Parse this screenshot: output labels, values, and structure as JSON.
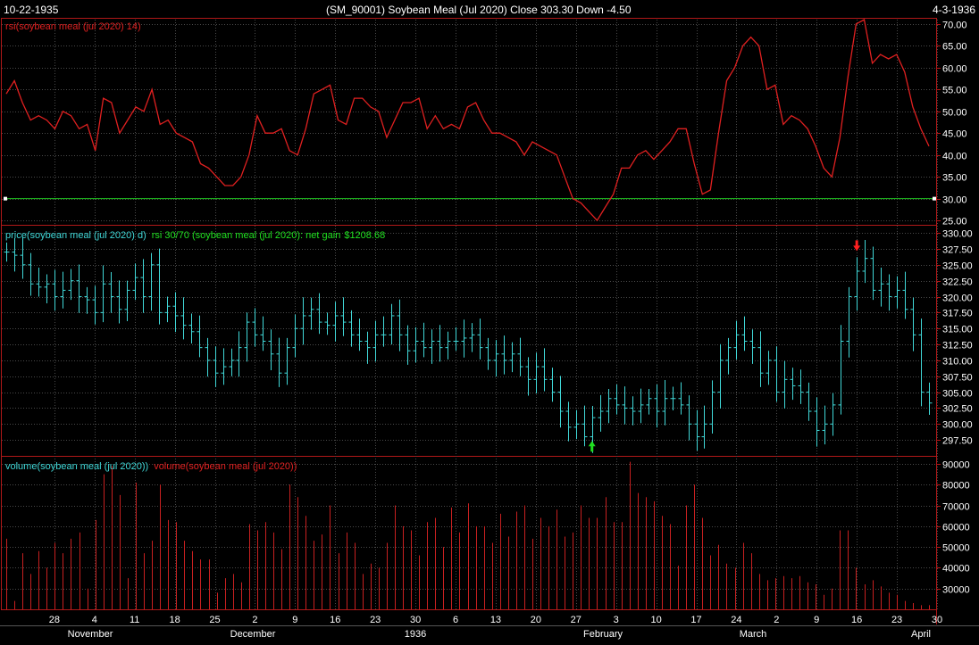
{
  "header": {
    "start_date": "10-22-1935",
    "end_date": "4-3-1936",
    "title": "(SM_90001)  Soybean Meal (Jul 2020)    Close 303.30   Down -4.50"
  },
  "colors": {
    "background": "#000000",
    "panel_border": "#b01818",
    "grid": "#4a4a4a",
    "rsi_line": "#e02020",
    "threshold_line": "#20c020",
    "price_bar": "#40d8d8",
    "volume_bar": "#c82020",
    "buy_arrow": "#20e020",
    "sell_arrow": "#ff2020",
    "net_gain": "#20e020",
    "label_cyan": "#40d8d8",
    "label_red": "#e02020"
  },
  "chart_data": [
    {
      "type": "line",
      "panel": "rsi",
      "label": "rsi(soybean meal (jul 2020) 14)",
      "ylim": [
        24,
        71
      ],
      "yticks": [
        "70.00",
        "65.00",
        "60.00",
        "55.00",
        "50.00",
        "45.00",
        "40.00",
        "35.00",
        "30.00",
        "25.00"
      ],
      "threshold": 30,
      "values": [
        54,
        57,
        52,
        48,
        49,
        48,
        46,
        50,
        49,
        46,
        47,
        41,
        53,
        52,
        45,
        48,
        51,
        50,
        55,
        47,
        48,
        45,
        44,
        43,
        38,
        37,
        35,
        33,
        33,
        35,
        40,
        49,
        45,
        45,
        46,
        41,
        40,
        46,
        54,
        55,
        56,
        48,
        47,
        53,
        53,
        51,
        50,
        44,
        48,
        52,
        52,
        53,
        46,
        49,
        46,
        47,
        46,
        51,
        52,
        48,
        45,
        45,
        44,
        43,
        40,
        43,
        42,
        41,
        40,
        35,
        30,
        29,
        27,
        25,
        28,
        31,
        37,
        37,
        40,
        41,
        39,
        41,
        43,
        46,
        46,
        38,
        31,
        32,
        45,
        57,
        60,
        65,
        67,
        65,
        55,
        56,
        47,
        49,
        48,
        46,
        42,
        37,
        35,
        44,
        58,
        70,
        71,
        61,
        63,
        62,
        63,
        59,
        51,
        46,
        42
      ]
    },
    {
      "type": "bar",
      "panel": "price",
      "label": "price(soybean meal (jul 2020) d)",
      "system_label": "rsi 30/70 (soybean meal (jul 2020): net gain",
      "net_gain": "$1208.68",
      "ylim": [
        295,
        331
      ],
      "yticks": [
        "330.00",
        "327.50",
        "325.00",
        "322.50",
        "320.00",
        "317.50",
        "315.00",
        "312.50",
        "310.00",
        "307.50",
        "305.00",
        "302.50",
        "300.00",
        "297.50"
      ],
      "values": [
        327,
        326.5,
        325,
        322,
        321.5,
        322,
        320,
        321,
        322.5,
        320,
        319.5,
        317.5,
        322,
        320,
        318,
        321,
        323,
        320,
        325,
        317.5,
        318.5,
        317,
        315.5,
        314.5,
        312,
        310,
        308,
        309,
        310,
        312,
        316,
        314,
        313,
        311,
        308,
        312,
        315,
        317,
        318,
        316,
        315.5,
        317,
        316,
        314,
        313,
        312,
        314,
        314,
        317,
        314,
        311.5,
        313,
        312,
        313,
        312,
        313,
        313,
        313.5,
        314,
        312,
        310,
        311,
        310,
        311,
        309,
        307,
        309,
        307,
        305,
        302,
        299.5,
        300,
        298,
        301,
        302,
        304,
        303,
        302.5,
        302,
        303,
        304,
        302,
        304,
        304,
        303,
        300,
        298,
        300,
        305,
        310,
        312,
        314,
        313,
        312,
        308,
        310,
        305,
        307,
        306,
        305,
        302,
        299,
        300,
        303,
        313,
        320,
        324,
        326,
        321,
        322,
        320,
        321,
        318,
        314,
        305,
        303.3
      ],
      "signals": [
        {
          "type": "buy",
          "index": 73
        },
        {
          "type": "sell",
          "index": 106
        }
      ]
    },
    {
      "type": "bar",
      "panel": "volume",
      "labels": [
        "volume(soybean meal (jul 2020))",
        "volume(soybean meal (jul 2020))"
      ],
      "ylim": [
        20000,
        93000
      ],
      "yticks": [
        "90000",
        "80000",
        "70000",
        "60000",
        "50000",
        "40000",
        "30000"
      ],
      "values": [
        54000,
        24000,
        47000,
        37000,
        48000,
        40000,
        52000,
        47000,
        54000,
        57000,
        30000,
        63000,
        85000,
        89000,
        75000,
        35000,
        81000,
        47000,
        53000,
        80000,
        63000,
        62000,
        53000,
        48000,
        44000,
        44000,
        28000,
        35000,
        37000,
        33000,
        61000,
        58000,
        62000,
        57000,
        49000,
        80000,
        74000,
        65000,
        53000,
        56000,
        70000,
        47000,
        57000,
        52000,
        37000,
        42000,
        40000,
        52000,
        70000,
        60000,
        58000,
        46000,
        62000,
        64000,
        50000,
        69000,
        57000,
        71000,
        60000,
        60000,
        52000,
        66000,
        55000,
        67000,
        70000,
        54000,
        64000,
        60000,
        68000,
        55000,
        57000,
        70000,
        64000,
        64000,
        74000,
        62000,
        62000,
        91000,
        76000,
        74000,
        72000,
        65000,
        61000,
        41000,
        70000,
        80000,
        64000,
        46000,
        51000,
        42000,
        40000,
        52000,
        47000,
        37000,
        34000,
        35000,
        36000,
        35000,
        36000,
        33000,
        32000,
        27000,
        30000,
        58000,
        58000,
        40000,
        32000,
        34000,
        31000,
        28000,
        27000,
        24000,
        23000,
        22000,
        22000
      ]
    }
  ],
  "x_axis": {
    "day_labels": [
      "28",
      "4",
      "11",
      "18",
      "25",
      "2",
      "9",
      "16",
      "23",
      "30",
      "6",
      "13",
      "20",
      "27",
      "3",
      "10",
      "17",
      "24",
      "2",
      "9",
      "16",
      "23",
      "30"
    ],
    "month_labels": [
      "November",
      "December",
      "1936",
      "February",
      "March",
      "April"
    ]
  }
}
